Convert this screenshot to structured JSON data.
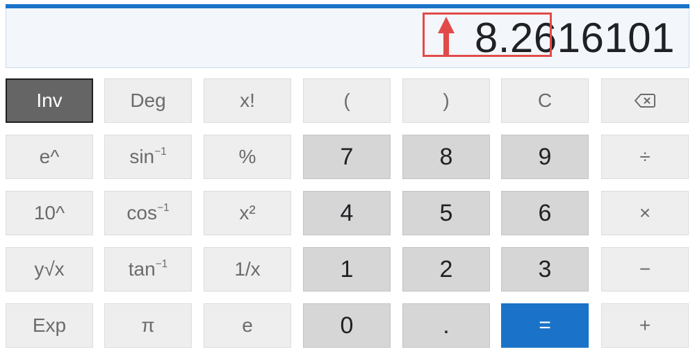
{
  "display": {
    "value": "8.2616101"
  },
  "colors": {
    "accent": "#1a73c8",
    "highlight": "#e24a4a"
  },
  "keys": {
    "row1": [
      "Inv",
      "Deg",
      "x!",
      "(",
      ")",
      "C"
    ],
    "row2": [
      "e^",
      "sin",
      "%",
      "7",
      "8",
      "9",
      "÷"
    ],
    "row3": [
      "10^",
      "cos",
      "x²",
      "4",
      "5",
      "6",
      "×"
    ],
    "row4": [
      "y√x",
      "tan",
      "1/x",
      "1",
      "2",
      "3",
      "−"
    ],
    "row5": [
      "Exp",
      "π",
      "e",
      "0",
      ".",
      "=",
      "+"
    ],
    "inverse_superscript": "−1"
  },
  "icons": {
    "backspace": "backspace-icon",
    "annotation_arrow": "arrow-up-icon"
  }
}
